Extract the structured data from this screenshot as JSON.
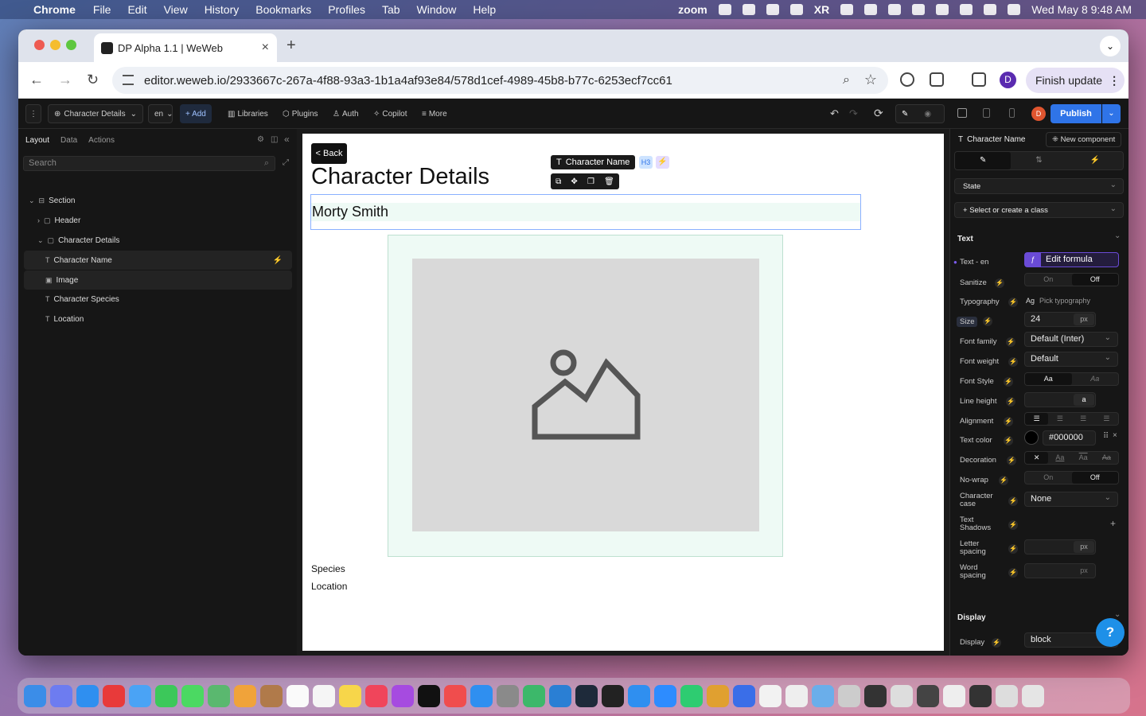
{
  "menubar": {
    "app": "Chrome",
    "items": [
      "File",
      "Edit",
      "View",
      "History",
      "Bookmarks",
      "Profiles",
      "Tab",
      "Window",
      "Help"
    ],
    "zoom_label": "zoom",
    "xr_label": "XR",
    "clock": "Wed May 8  9:48 AM"
  },
  "browser": {
    "tab_title": "DP Alpha 1.1 | WeWeb",
    "url": "editor.weweb.io/2933667c-267a-4f88-93a3-1b1a4af93e84/578d1cef-4989-45b8-b77c-6253ecf7cc61",
    "avatar_letter": "D",
    "finish_update": "Finish update"
  },
  "toolbar": {
    "page_select": "Character Details",
    "lang": "en",
    "add": "+ Add",
    "libraries": "Libraries",
    "plugins": "Plugins",
    "auth": "Auth",
    "copilot": "Copilot",
    "more": "More",
    "user_letter": "D",
    "publish": "Publish"
  },
  "left_panel": {
    "tabs": [
      "Layout",
      "Data",
      "Actions"
    ],
    "search_placeholder": "Search",
    "tree": [
      {
        "label": "Section",
        "glyph": "⊟"
      },
      {
        "label": "Header",
        "glyph": "▢"
      },
      {
        "label": "Character Details",
        "glyph": "▢"
      },
      {
        "label": "Character Name",
        "glyph": "T"
      },
      {
        "label": "Image",
        "glyph": "▣"
      },
      {
        "label": "Character Species",
        "glyph": "T"
      },
      {
        "label": "Location",
        "glyph": "T"
      }
    ]
  },
  "canvas": {
    "back": "< Back",
    "title": "Character Details",
    "character_name": "Morty Smith",
    "chip_label": "Character Name",
    "chip_tag": "H3",
    "species": "Species",
    "location": "Location"
  },
  "right_panel": {
    "element": "Character Name",
    "new_component": "New component",
    "state": "State",
    "class_select": "Select or create a class",
    "section_text": "Text",
    "text_lang_label": "Text - en",
    "edit_formula": "Edit formula",
    "sanitize": "Sanitize",
    "on": "On",
    "off": "Off",
    "typography": "Typography",
    "pick_typography": "Pick typography",
    "size": "Size",
    "size_value": "24",
    "px": "px",
    "font_family": "Font family",
    "font_family_value": "Default (Inter)",
    "font_weight": "Font weight",
    "font_weight_value": "Default",
    "font_style": "Font Style",
    "aa": "Aa",
    "line_height": "Line height",
    "lh_unit": "a",
    "alignment": "Alignment",
    "text_color": "Text color",
    "text_color_value": "#000000",
    "decoration": "Decoration",
    "nowrap": "No-wrap",
    "char_case": "Character case",
    "char_case_value": "None",
    "text_shadows": "Text Shadows",
    "letter_spacing": "Letter spacing",
    "word_spacing": "Word spacing",
    "section_display": "Display",
    "display": "Display",
    "display_value": "block"
  },
  "colors": {
    "publish": "#2f74e8",
    "selection": "#8ab0ff",
    "text_color_swatch": "#000000"
  }
}
